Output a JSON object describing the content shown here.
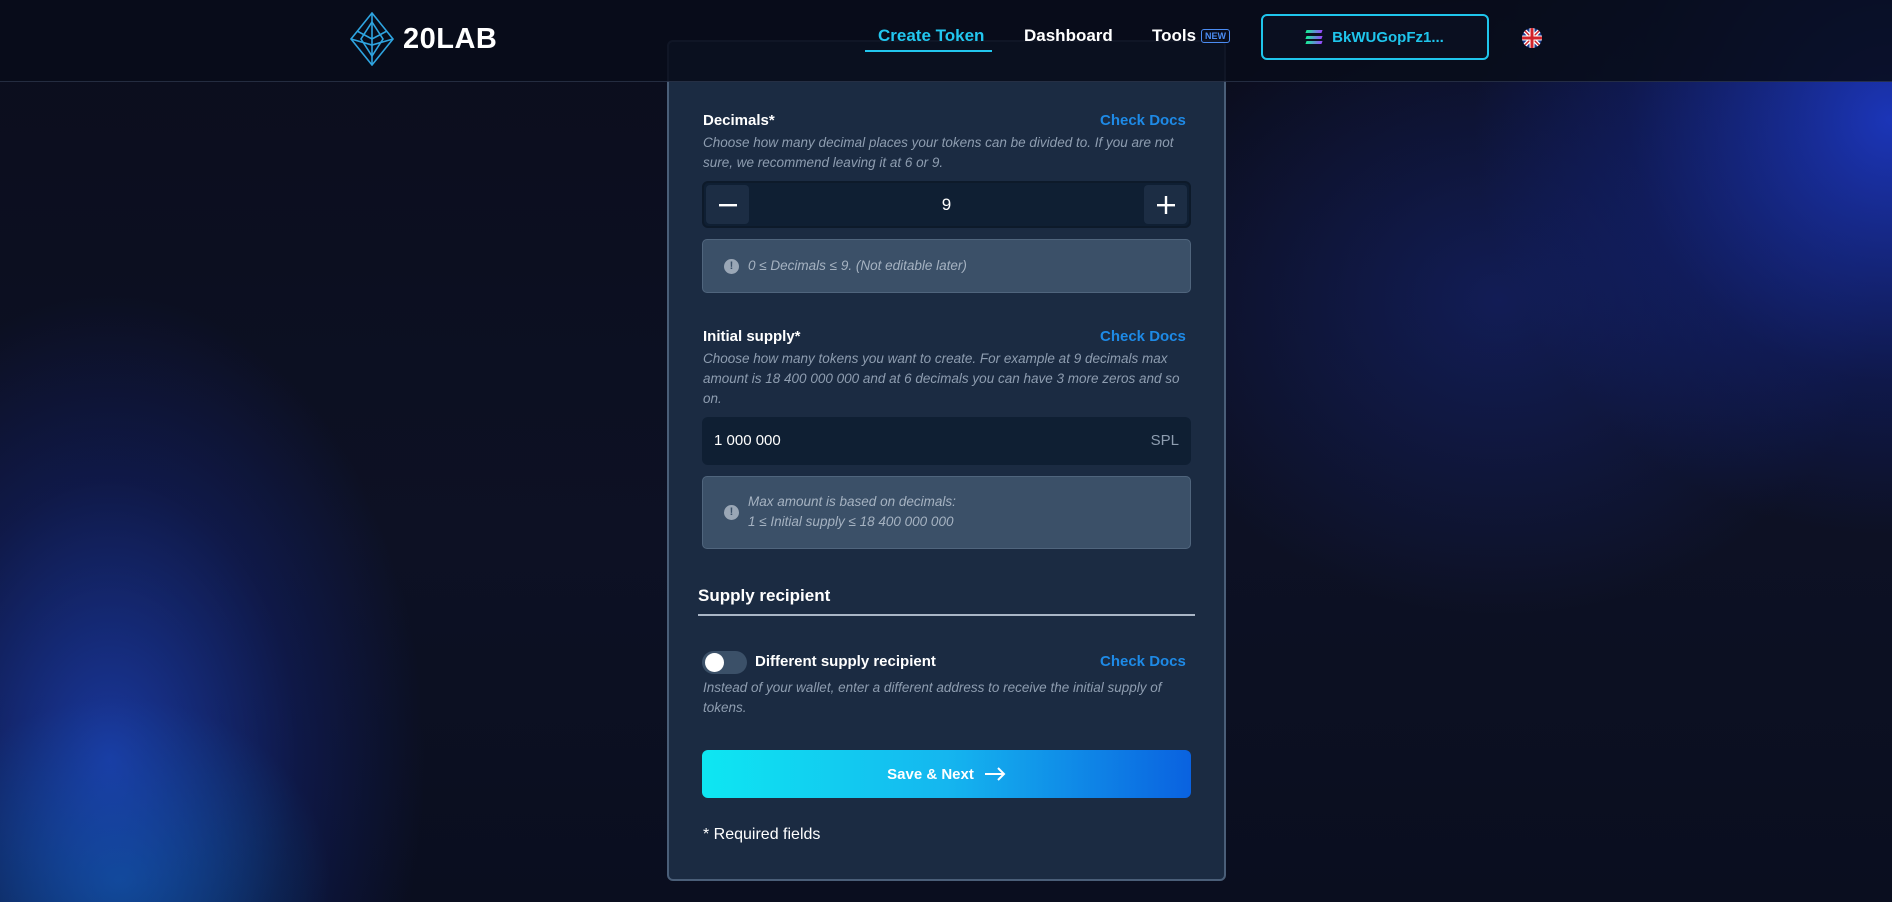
{
  "nav": {
    "logo_text": "20LAB",
    "links": [
      {
        "label": "Create Token",
        "active": true
      },
      {
        "label": "Dashboard"
      },
      {
        "label": "Tools",
        "badge": "NEW"
      }
    ],
    "wallet_address": "BkWUGopFz1...",
    "language_icon": "uk-flag-icon"
  },
  "decimals": {
    "label": "Decimals*",
    "docs_link": "Check Docs",
    "description": "Choose how many decimal places your tokens can be divided to. If you are not sure, we recommend leaving it at 6 or 9.",
    "value": "9",
    "decrement_icon": "minus-icon",
    "increment_icon": "plus-icon",
    "info": "0 ≤ Decimals ≤ 9. (Not editable later)"
  },
  "initial_supply": {
    "label": "Initial supply*",
    "docs_link": "Check Docs",
    "description": "Choose how many tokens you want to create. For example at 9 decimals max amount is 18 400 000 000 and at 6 decimals you can have 3 more zeros and so on.",
    "value": "1 000 000",
    "unit": "SPL",
    "info_line1": "Max amount is based on decimals:",
    "info_line2": "1 ≤ Initial supply ≤ 18 400 000 000"
  },
  "supply_recipient": {
    "section_title": "Supply recipient",
    "toggle_label": "Different supply recipient",
    "toggle_on": false,
    "docs_link": "Check Docs",
    "description": "Instead of your wallet, enter a different address to receive the initial supply of tokens."
  },
  "save_button": "Save & Next",
  "required_note": "* Required fields",
  "colors": {
    "accent": "#22c6ee",
    "link": "#1e8ae6",
    "panel": "#1b2b42"
  }
}
